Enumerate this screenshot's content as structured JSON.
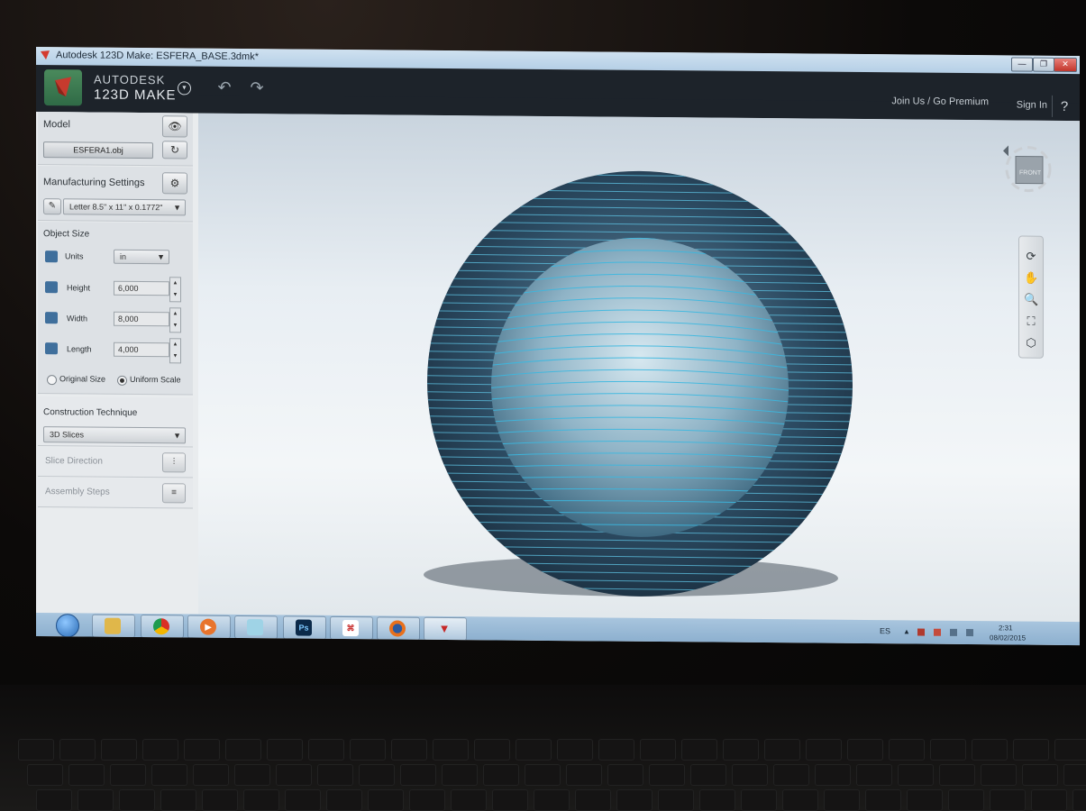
{
  "window": {
    "title": "Autodesk 123D Make: ESFERA_BASE.3dmk*",
    "controls": [
      "—",
      "❐",
      "✕"
    ]
  },
  "app": {
    "brand_line1": "AUTODESK",
    "brand_line2": "123D MAKE",
    "join_link": "Join Us / Go Premium",
    "signin_link": "Sign In",
    "help": "?"
  },
  "panel": {
    "model": {
      "title": "Model",
      "file": "ESFERA1.obj"
    },
    "manufacturing": {
      "title": "Manufacturing Settings",
      "sheet": "Letter 8.5\" x 11\" x 0.1772\""
    },
    "object_size": {
      "title": "Object Size",
      "units_label": "Units",
      "units_value": "in",
      "height_label": "Height",
      "height_value": "6,000",
      "width_label": "Width",
      "width_value": "8,000",
      "length_label": "Length",
      "length_value": "4,000",
      "original_size": "Original Size",
      "uniform_scale": "Uniform Scale"
    },
    "construction": {
      "title": "Construction Technique",
      "value": "3D Slices"
    },
    "slice_direction": "Slice Direction",
    "assembly_steps": "Assembly Steps"
  },
  "viewport": {
    "viewcube_face": "FRONT"
  },
  "taskbar": {
    "language": "ES",
    "time": "2:31",
    "date": "08/02/2015",
    "apps": [
      "explorer",
      "chrome",
      "media-player",
      "notes",
      "photoshop",
      "acrobat",
      "firefox",
      "123d-make"
    ],
    "ps_label": "Ps"
  },
  "colors": {
    "accent": "#3fb3d6",
    "header": "#1d232a"
  }
}
